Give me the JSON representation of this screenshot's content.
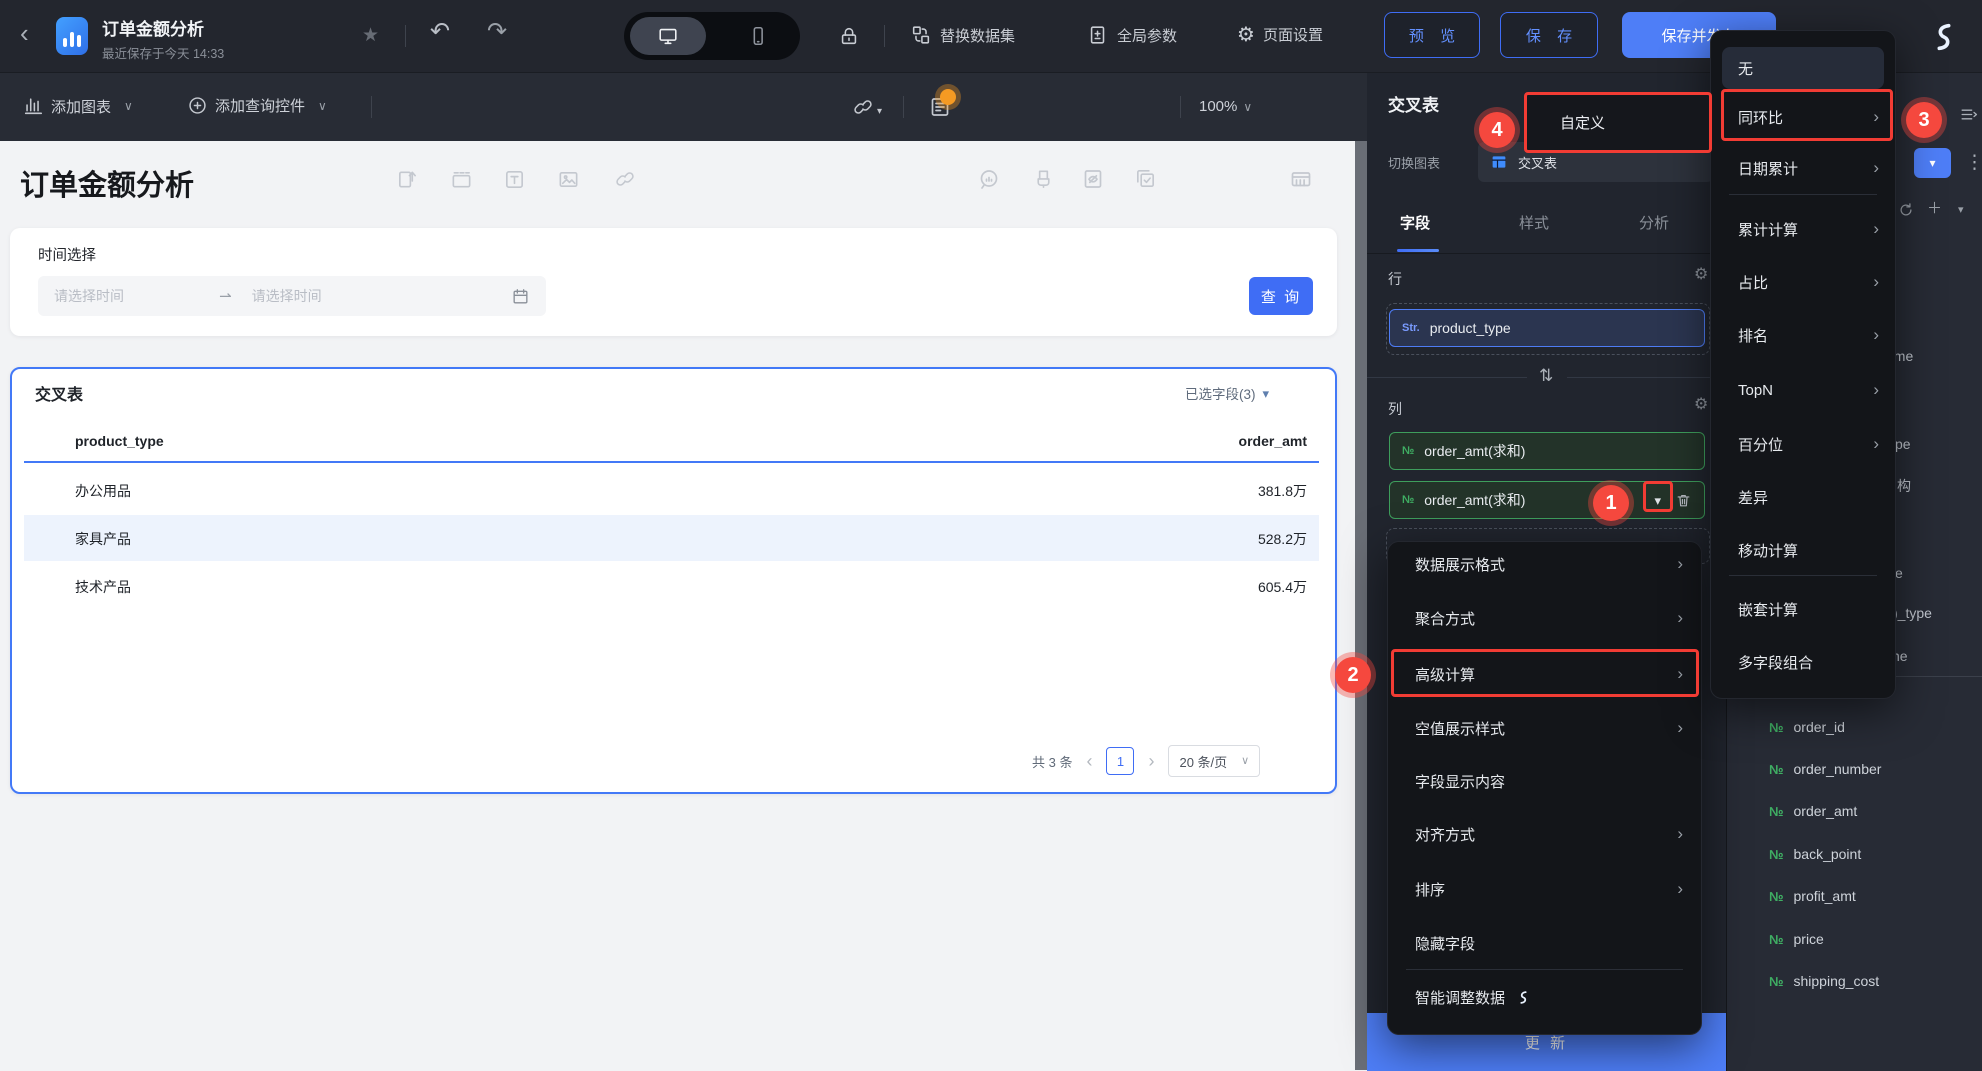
{
  "icons": {
    "back": "‹",
    "star": "★",
    "undo": "↶",
    "redo": "↷",
    "chevron_down": "∨",
    "caret_down": "▾",
    "more_vertical": "⋮",
    "swap": "⇅",
    "gear": "⚙",
    "numero": "№",
    "plus": "＋",
    "chevron_left": "‹",
    "chevron_right": "›",
    "range_arrow": "⇀"
  },
  "header": {
    "title": "订单金额分析",
    "subtitle": "最近保存于今天 14:33",
    "replace_dataset": "替换数据集",
    "global_params": "全局参数",
    "page_settings": "页面设置",
    "preview": "预 览",
    "save": "保 存",
    "save_publish": "保存并发布"
  },
  "toolbar": {
    "add_chart": "添加图表",
    "add_query": "添加查询控件",
    "zoom_level": "100%"
  },
  "canvas": {
    "page_title": "订单金额分析",
    "filter": {
      "label": "时间选择",
      "placeholder_start": "请选择时间",
      "placeholder_end": "请选择时间",
      "query_button": "查 询"
    },
    "table_card": {
      "title": "交叉表",
      "selected_fields": "已选字段(3)",
      "columns": [
        "product_type",
        "order_amt"
      ],
      "rows": [
        [
          "办公用品",
          "381.8万"
        ],
        [
          "家具产品",
          "528.2万"
        ],
        [
          "技术产品",
          "605.4万"
        ]
      ],
      "pagination": {
        "total": "共 3 条",
        "page": "1",
        "page_size": "20 条/页"
      }
    }
  },
  "panel": {
    "title": "交叉表",
    "switch_chart": "切换图表",
    "chart_type": "交叉表",
    "tabs": [
      "字段",
      "样式",
      "分析"
    ],
    "rows_label": "行",
    "cols_label": "列",
    "row_field": {
      "tag": "Str.",
      "name": "product_type"
    },
    "col_field_1": {
      "tag": "№",
      "name": "order_amt(求和)"
    },
    "col_field_2": {
      "tag": "№",
      "name": "order_amt(求和)"
    },
    "update_button": "更 新"
  },
  "field_menu": {
    "items": [
      {
        "label": "数据展示格式",
        "arrow": "›"
      },
      {
        "label": "聚合方式",
        "arrow": "›"
      },
      {
        "label": "高级计算",
        "arrow": "›"
      },
      {
        "label": "空值展示样式",
        "arrow": "›"
      },
      {
        "label": "字段显示内容",
        "arrow": ""
      },
      {
        "label": "对齐方式",
        "arrow": "›"
      },
      {
        "label": "排序",
        "arrow": "›"
      },
      {
        "label": "隐藏字段",
        "arrow": ""
      },
      {
        "label": "智能调整数据",
        "arrow": ""
      }
    ]
  },
  "calc_submenu": {
    "items": [
      {
        "label": "无",
        "arrow": ""
      },
      {
        "label": "同环比",
        "arrow": "›"
      },
      {
        "label": "日期累计",
        "arrow": "›"
      },
      {
        "label": "累计计算",
        "arrow": "›"
      },
      {
        "label": "占比",
        "arrow": "›"
      },
      {
        "label": "排名",
        "arrow": "›"
      },
      {
        "label": "TopN",
        "arrow": "›"
      },
      {
        "label": "百分位",
        "arrow": "›"
      },
      {
        "label": "差异",
        "arrow": ""
      },
      {
        "label": "移动计算",
        "arrow": ""
      },
      {
        "label": "嵌套计算",
        "arrow": ""
      },
      {
        "label": "多字段组合",
        "arrow": ""
      }
    ]
  },
  "custom_popup": {
    "label": "自定义"
  },
  "badges": {
    "one": "1",
    "two": "2",
    "three": "3",
    "four": "4"
  },
  "dataset_panel": {
    "fragments": [
      "ame",
      "pe",
      "构",
      "e",
      ")_type",
      "ne"
    ],
    "fields": [
      "order_id",
      "order_number",
      "order_amt",
      "back_point",
      "profit_amt",
      "price",
      "shipping_cost"
    ]
  }
}
